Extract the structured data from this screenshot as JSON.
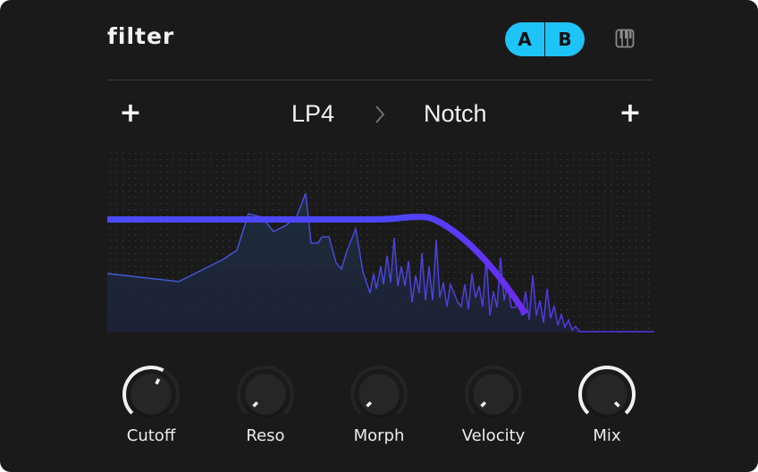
{
  "header": {
    "title": "filter",
    "ab_toggle": {
      "a_label": "A",
      "b_label": "B",
      "color": "#1ec3f7"
    },
    "keyboard_icon": "piano-keys-icon"
  },
  "filter_chain": {
    "add_left_label": "+",
    "first_filter": "LP4",
    "separator_icon": "chevron-right-icon",
    "second_filter": "Notch",
    "add_right_label": "+"
  },
  "display": {
    "curve_color": "#4a4aff",
    "spectrum_color": "#3d5fd6",
    "spectrum_high_color": "#5a2fe0",
    "curve": {
      "type": "lowpass",
      "cutoff_position": 0.6,
      "flat_level": 0.62
    }
  },
  "knobs": [
    {
      "label": "Cutoff",
      "value": 0.6
    },
    {
      "label": "Reso",
      "value": 0.0
    },
    {
      "label": "Morph",
      "value": 0.0
    },
    {
      "label": "Velocity",
      "value": 0.0
    },
    {
      "label": "Mix",
      "value": 1.0
    }
  ]
}
